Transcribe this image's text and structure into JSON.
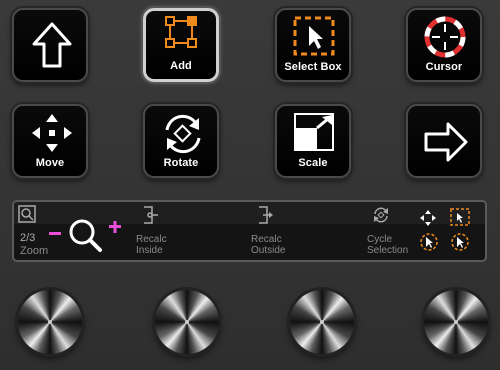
{
  "buttons": [
    {
      "id": "b1",
      "label": "",
      "icon": "up-arrow-icon"
    },
    {
      "id": "b2",
      "label": "Add",
      "icon": "add-vertex-icon",
      "selected": true
    },
    {
      "id": "b3",
      "label": "Select Box",
      "icon": "select-box-icon"
    },
    {
      "id": "b4",
      "label": "Cursor",
      "icon": "cursor-target-icon"
    },
    {
      "id": "b5",
      "label": "Move",
      "icon": "move-arrows-icon"
    },
    {
      "id": "b6",
      "label": "Rotate",
      "icon": "rotate-icon"
    },
    {
      "id": "b7",
      "label": "Scale",
      "icon": "scale-icon"
    },
    {
      "id": "b8",
      "label": "",
      "icon": "right-arrow-icon"
    }
  ],
  "screen": {
    "page": "2/3",
    "zoom_label": "Zoom",
    "slots": [
      {
        "line1": "Recalc",
        "line2": "Inside",
        "icon": "recalc-inside-icon"
      },
      {
        "line1": "Recalc",
        "line2": "Outside",
        "icon": "recalc-outside-icon"
      },
      {
        "line1": "Cycle",
        "line2": "Selection",
        "icon": "cycle-selection-icon"
      }
    ]
  },
  "colors": {
    "accent_orange": "#f08a1c",
    "accent_red": "#e03030",
    "zoom_pink": "#e84fd8"
  }
}
